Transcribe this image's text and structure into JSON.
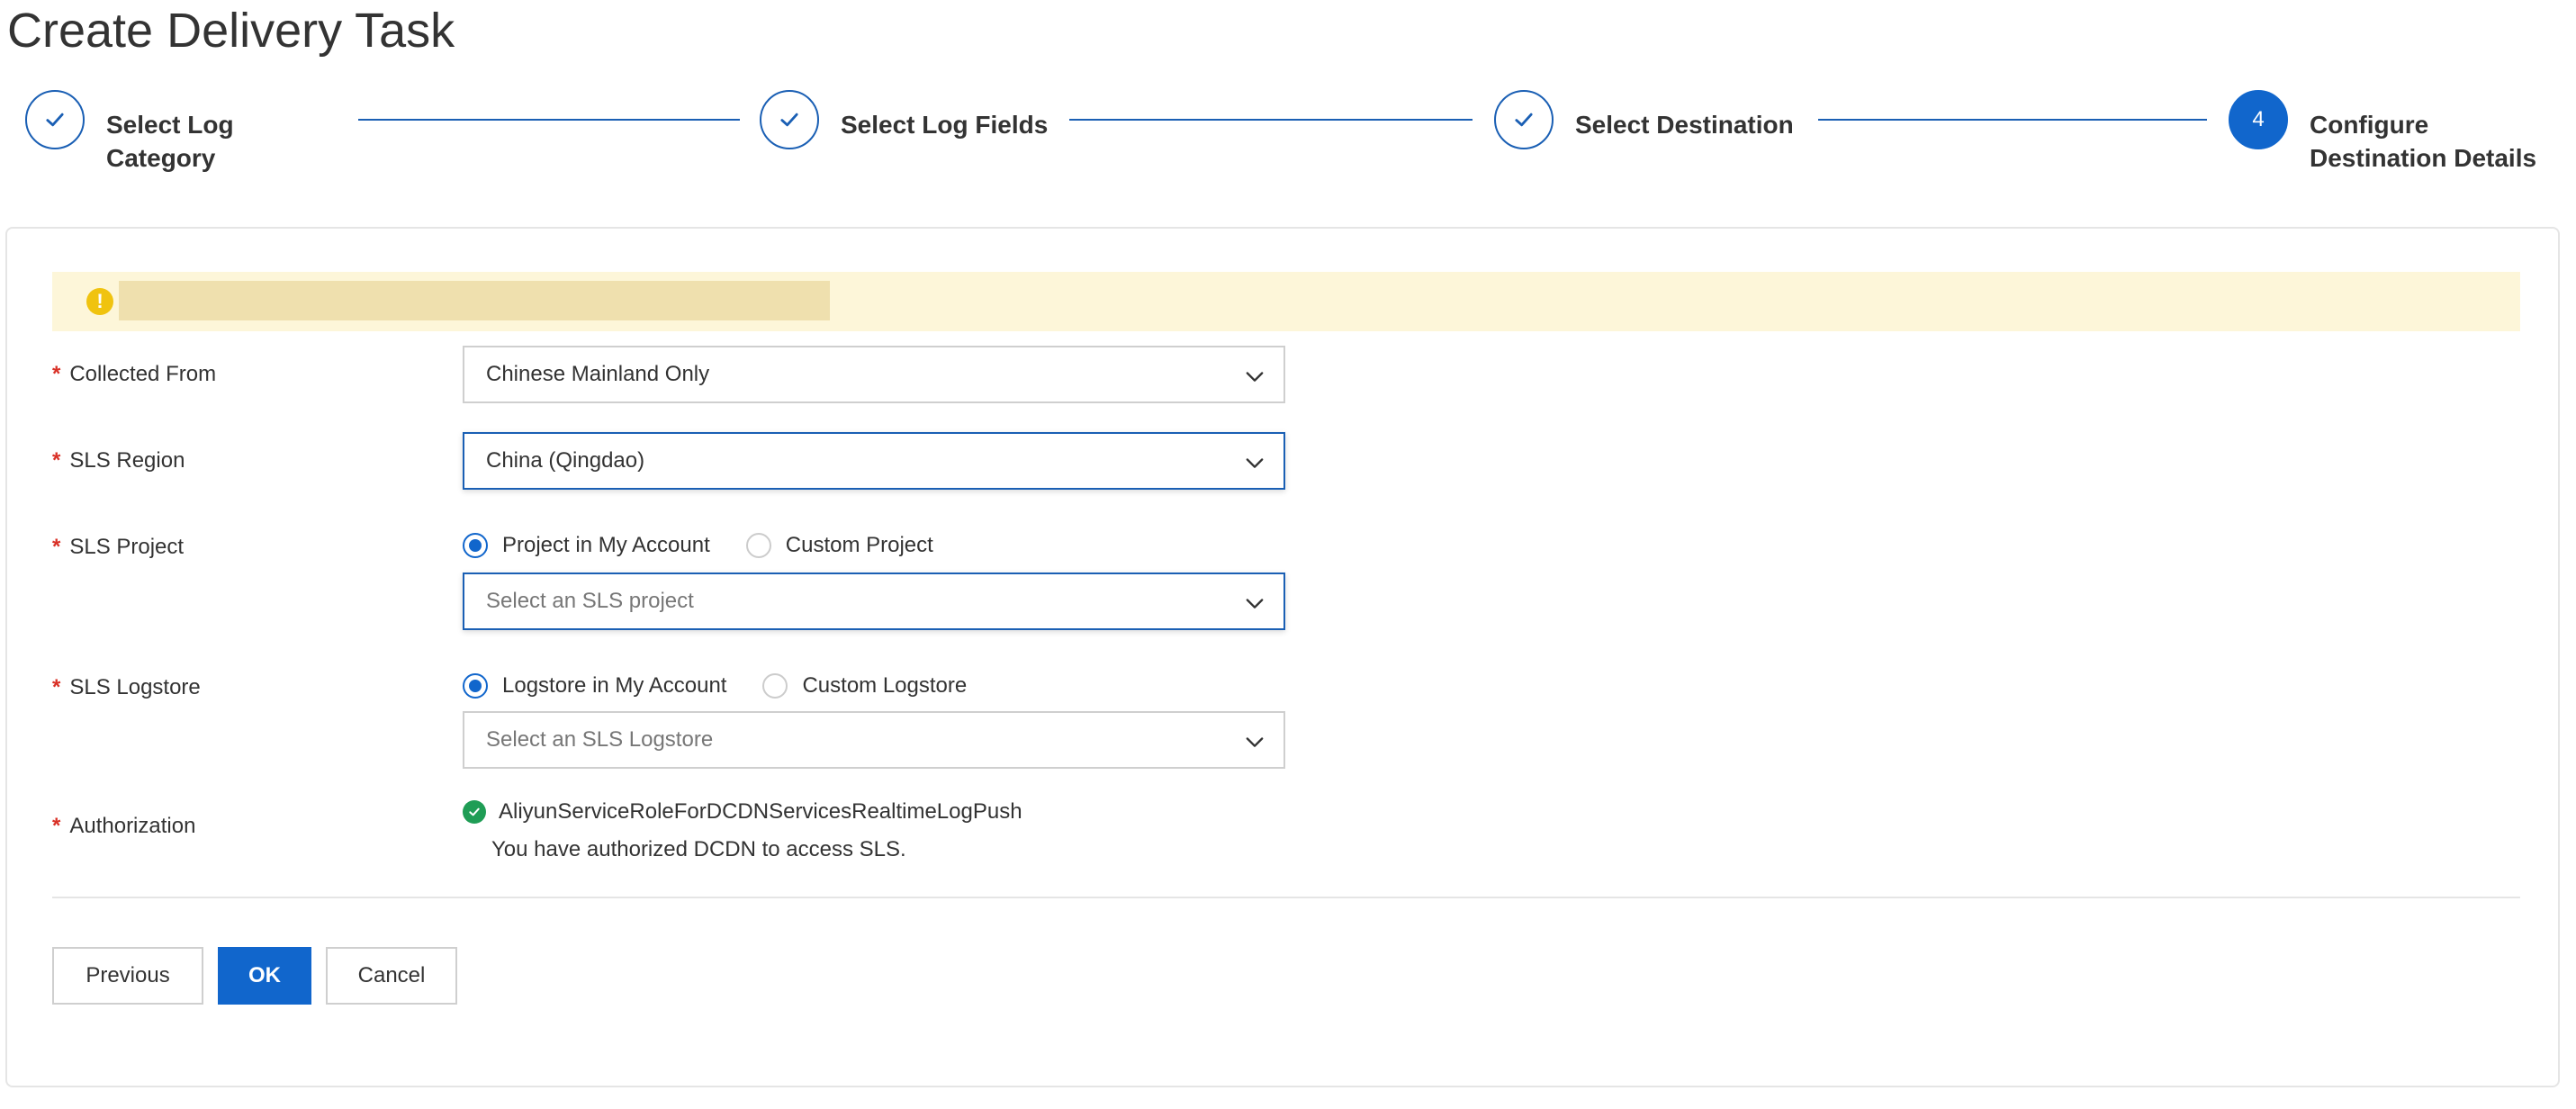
{
  "page": {
    "title": "Create Delivery Task"
  },
  "steps": [
    {
      "label_line1": "Select Log",
      "label_line2": "Category",
      "state": "done"
    },
    {
      "label_line1": "Select Log Fields",
      "label_line2": "",
      "state": "done"
    },
    {
      "label_line1": "Select Destination",
      "label_line2": "",
      "state": "done"
    },
    {
      "number": "4",
      "label_line1": "Configure",
      "label_line2": "Destination Details",
      "state": "active"
    }
  ],
  "alert": {
    "icon": "warning-icon",
    "text": ""
  },
  "form": {
    "collected_from": {
      "label": "Collected From",
      "value": "Chinese Mainland Only"
    },
    "sls_region": {
      "label": "SLS Region",
      "value": "China (Qingdao)"
    },
    "sls_project": {
      "label": "SLS Project",
      "radio_options": [
        "Project in My Account",
        "Custom Project"
      ],
      "selected": "Project in My Account",
      "placeholder": "Select an SLS project"
    },
    "sls_logstore": {
      "label": "SLS Logstore",
      "radio_options": [
        "Logstore in My Account",
        "Custom Logstore"
      ],
      "selected": "Logstore in My Account",
      "placeholder": "Select an SLS Logstore"
    },
    "authorization": {
      "label": "Authorization",
      "role": "AliyunServiceRoleForDCDNServicesRealtimeLogPush",
      "note": "You have authorized DCDN to access SLS."
    }
  },
  "buttons": {
    "previous": "Previous",
    "ok": "OK",
    "cancel": "Cancel"
  },
  "colors": {
    "primary": "#1166cc",
    "required": "#d93026",
    "success": "#1f9d55",
    "warning": "#f0c30f",
    "alert_bg": "#fdf6d9"
  }
}
